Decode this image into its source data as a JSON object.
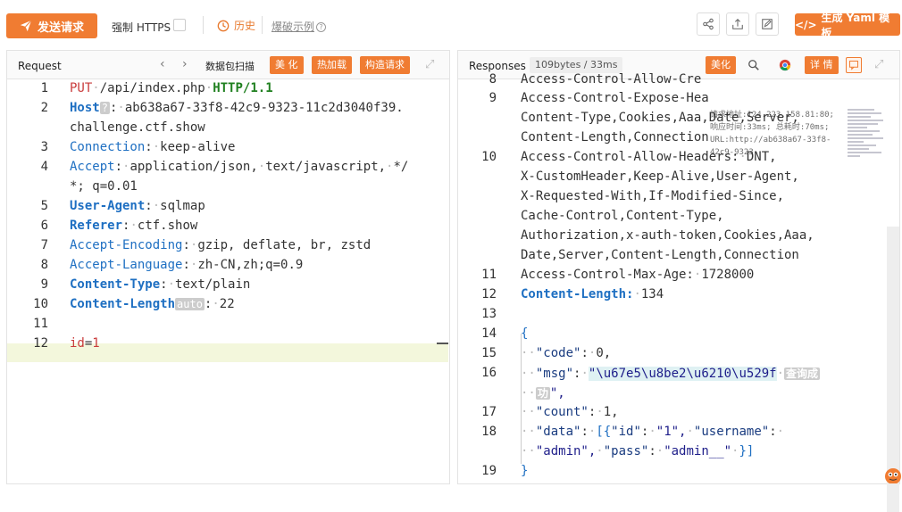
{
  "toolbar": {
    "send_label": "发送请求",
    "https_label": "强制 HTTPS",
    "history_label": "历史",
    "examples_label": "爆破示例",
    "yaml_label": "生成 Yaml 模板"
  },
  "request_pane": {
    "title": "Request",
    "scan_label": "数据包扫描",
    "btn_beautify": "美 化",
    "btn_hotload": "热加载",
    "btn_build": "构造请求",
    "lines": [
      {
        "n": "1"
      },
      {
        "n": "2"
      },
      {
        "n": "3"
      },
      {
        "n": "4"
      },
      {
        "n": "5"
      },
      {
        "n": "6"
      },
      {
        "n": "7"
      },
      {
        "n": "8"
      },
      {
        "n": "9"
      },
      {
        "n": "10"
      },
      {
        "n": "11"
      },
      {
        "n": "12"
      }
    ],
    "method": "PUT",
    "path": "/api/index.php",
    "proto": "HTTP/1.1",
    "host_key": "Host",
    "host_q": "?",
    "host_val1": "ab638a67-33f8-42c9-9323-11c2d3040f39.",
    "host_val2": "challenge.ctf.show",
    "conn_key": "Connection",
    "conn_val": "keep-alive",
    "accept_key": "Accept",
    "accept_val1": "application/json,",
    "accept_val2": "text/javascript,",
    "accept_val3": "*/",
    "accept_val4": "*; q=0.01",
    "ua_key": "User-Agent",
    "ua_val": "sqlmap",
    "ref_key": "Referer",
    "ref_val": "ctf.show",
    "ae_key": "Accept-Encoding",
    "ae_val": "gzip, deflate, br, zstd",
    "al_key": "Accept-Language",
    "al_val": "zh-CN,zh;q=0.9",
    "ct_key": "Content-Type",
    "ct_val": "text/plain",
    "cl_key": "Content-Length",
    "cl_pill": "auto",
    "cl_val": "22",
    "body_key": "id",
    "body_eq": "=",
    "body_val": "1"
  },
  "response_pane": {
    "title": "Responses",
    "stats": "109bytes / 33ms",
    "btn_beautify": "美化",
    "btn_detail": "详 情",
    "tooltip": "请求地址:124.223.158.81:80; 响应时间:33ms; 总耗时:70ms; URL:http://ab638a67-33f8-42c9-9323",
    "lines": [
      {
        "n": "8"
      },
      {
        "n": "9"
      },
      {
        "n": "10"
      },
      {
        "n": "11"
      },
      {
        "n": "12"
      },
      {
        "n": "13"
      },
      {
        "n": "14"
      },
      {
        "n": "15"
      },
      {
        "n": "16"
      },
      {
        "n": "17"
      },
      {
        "n": "18"
      },
      {
        "n": "19"
      }
    ],
    "l8": "Access-Control-Allow-Cre",
    "l9a": "Access-Control-Expose-Hea",
    "l9b": "Content-Type,Cookies,Aaa,Date,Server,",
    "l9c": "Content-Length,Connection",
    "l10a": "Access-Control-Allow-Headers:",
    "l10a_val": "DNT,",
    "l10b": "X-CustomHeader,Keep-Alive,User-Agent,",
    "l10c": "X-Requested-With,If-Modified-Since,",
    "l10d": "Cache-Control,Content-Type,",
    "l10e": "Authorization,x-auth-token,Cookies,Aaa,",
    "l10f": "Date,Server,Content-Length,Connection",
    "l11": "Access-Control-Max-Age:",
    "l11_val": "1728000",
    "l12_key": "Content-Length:",
    "l12_val": "134",
    "l14": "{",
    "code_key": "\"code\"",
    "code_val": "0,",
    "msg_key": "\"msg\"",
    "msg_val": "\"\\u67e5\\u8be2\\u6210\\u529f",
    "msg_hint1": "查询成",
    "msg_hint2": "功",
    "msg_end": "\",",
    "count_key": "\"count\"",
    "count_val": "1,",
    "data_key": "\"data\"",
    "data_open": "[{",
    "id_key": "\"id\"",
    "id_val": "\"1\",",
    "user_key": "\"username\"",
    "user_val": "\"admin\",",
    "pass_key": "\"pass\"",
    "pass_val": "\"admin__\"",
    "data_close": "}]",
    "l19": "}"
  },
  "colors": {
    "accent": "#f07c32",
    "key_blue": "#1e6fc2",
    "method_red": "#c93b3b",
    "proto_green": "#208020"
  }
}
